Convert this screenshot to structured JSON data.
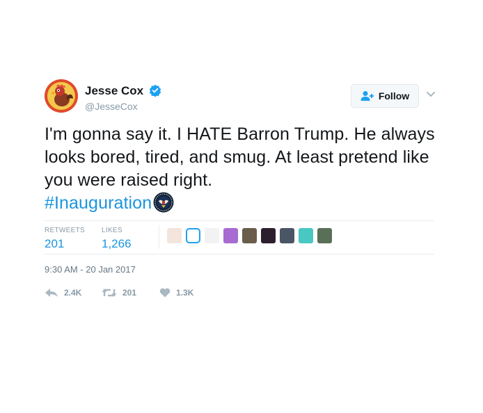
{
  "author": {
    "name": "Jesse Cox",
    "handle": "@JesseCox",
    "verified": true,
    "avatar_icon": "rooster-avatar"
  },
  "follow_button": {
    "label": "Follow",
    "icon": "add-user-icon"
  },
  "tweet": {
    "text": "I'm gonna say it. I HATE Barron Trump. He always looks bored, tired, and smug.  At least pretend like you were raised right.",
    "hashtag": "#Inauguration",
    "emoji": "presidential-seal-icon"
  },
  "stats": {
    "retweets_label": "RETWEETS",
    "retweets": "201",
    "likes_label": "LIKES",
    "likes": "1,266"
  },
  "timestamp": "9:30 AM - 20 Jan 2017",
  "actions": {
    "reply_count": "2.4K",
    "retweet_count": "201",
    "like_count": "1.3K"
  },
  "colors": {
    "link": "#1b95e0",
    "muted": "#8899a6",
    "verified": "#1da1f2"
  }
}
